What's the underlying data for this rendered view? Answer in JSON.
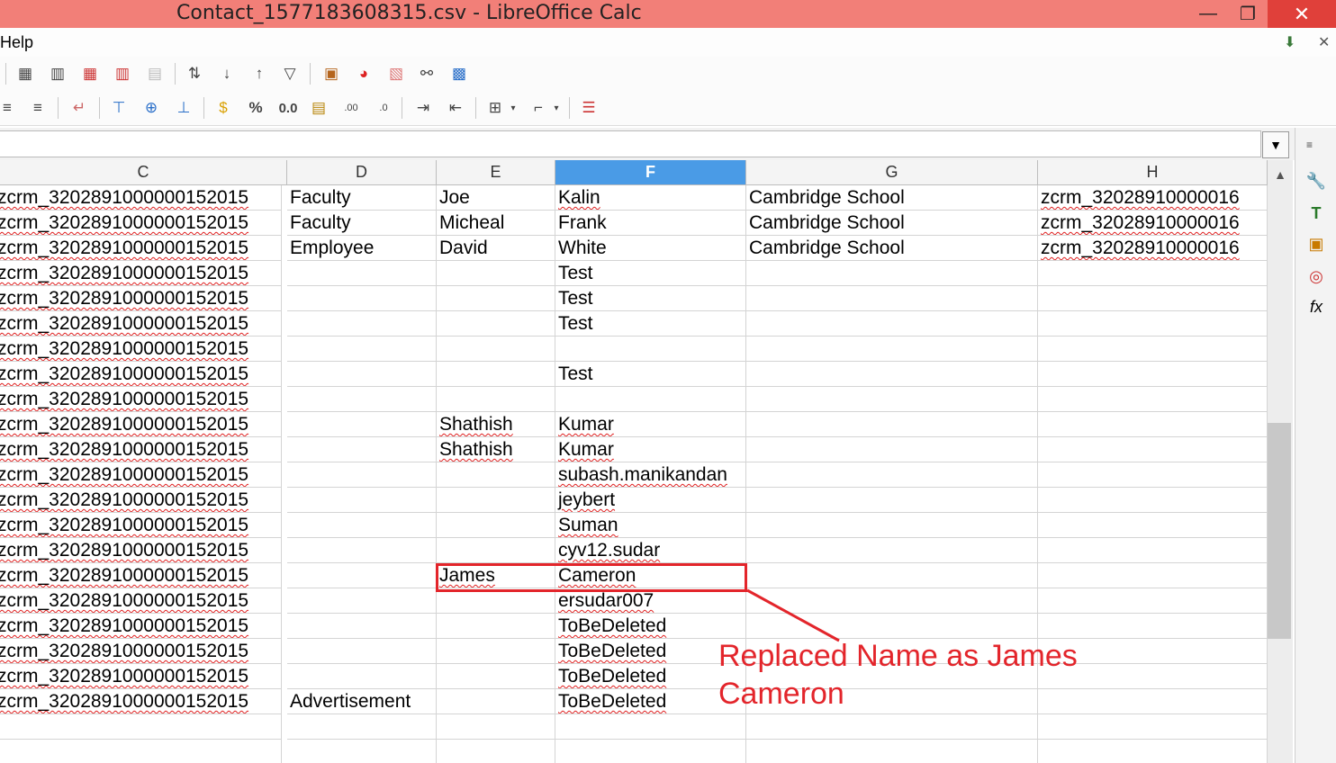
{
  "window": {
    "title": "Contact_1577183608315.csv - LibreOffice Calc",
    "minimize": "—",
    "maximize": "❐",
    "close": "✕"
  },
  "menu": {
    "help": "Help"
  },
  "formula": {
    "value": ""
  },
  "columns": [
    "C",
    "D",
    "E",
    "F",
    "G",
    "H"
  ],
  "selected_column": "F",
  "rows": [
    {
      "c": "zcrm_320289100000015201​5",
      "d": "Faculty",
      "e": "Joe",
      "f": "Kalin",
      "g": "Cambridge School",
      "h": "zcrm_32028910000016"
    },
    {
      "c": "zcrm_320289100000015201​5",
      "d": "Faculty",
      "e": "Micheal",
      "f": "Frank",
      "g": "Cambridge School",
      "h": "zcrm_32028910000016"
    },
    {
      "c": "zcrm_320289100000015201​5",
      "d": "Employee",
      "e": "David",
      "f": "White",
      "g": "Cambridge School",
      "h": "zcrm_32028910000016"
    },
    {
      "c": "zcrm_320289100000015201​5",
      "d": "",
      "e": "",
      "f": "Test",
      "g": "",
      "h": ""
    },
    {
      "c": "zcrm_320289100000015201​5",
      "d": "",
      "e": "",
      "f": "Test",
      "g": "",
      "h": ""
    },
    {
      "c": "zcrm_320289100000015201​5",
      "d": "",
      "e": "",
      "f": "Test",
      "g": "",
      "h": ""
    },
    {
      "c": "zcrm_320289100000015201​5",
      "d": "",
      "e": "",
      "f": "",
      "g": "",
      "h": ""
    },
    {
      "c": "zcrm_320289100000015201​5",
      "d": "",
      "e": "",
      "f": "Test",
      "g": "",
      "h": ""
    },
    {
      "c": "zcrm_320289100000015201​5",
      "d": "",
      "e": "",
      "f": "",
      "g": "",
      "h": ""
    },
    {
      "c": "zcrm_320289100000015201​5",
      "d": "",
      "e": "Shathish",
      "f": "Kumar",
      "g": "",
      "h": ""
    },
    {
      "c": "zcrm_320289100000015201​5",
      "d": "",
      "e": "Shathish",
      "f": "Kumar",
      "g": "",
      "h": ""
    },
    {
      "c": "zcrm_320289100000015201​5",
      "d": "",
      "e": "",
      "f": "subash.manikandan",
      "g": "",
      "h": ""
    },
    {
      "c": "zcrm_320289100000015201​5",
      "d": "",
      "e": "",
      "f": "jeybert",
      "g": "",
      "h": ""
    },
    {
      "c": "zcrm_320289100000015201​5",
      "d": "",
      "e": "",
      "f": "Suman",
      "g": "",
      "h": ""
    },
    {
      "c": "zcrm_320289100000015201​5",
      "d": "",
      "e": "",
      "f": "cyv12.sudar",
      "g": "",
      "h": ""
    },
    {
      "c": "zcrm_320289100000015201​5",
      "d": "",
      "e": "James",
      "f": "Cameron",
      "g": "",
      "h": ""
    },
    {
      "c": "zcrm_320289100000015201​5",
      "d": "",
      "e": "",
      "f": "ersudar007",
      "g": "",
      "h": ""
    },
    {
      "c": "zcrm_320289100000015201​5",
      "d": "",
      "e": "",
      "f": "ToBeDeleted",
      "g": "",
      "h": ""
    },
    {
      "c": "zcrm_320289100000015201​5",
      "d": "",
      "e": "",
      "f": "ToBeDeleted",
      "g": "",
      "h": ""
    },
    {
      "c": "zcrm_320289100000015201​5",
      "d": "",
      "e": "",
      "f": "ToBeDeleted",
      "g": "",
      "h": ""
    },
    {
      "c": "zcrm_320289100000015201​5",
      "d": "Advertisement",
      "e": "",
      "f": "ToBeDeleted",
      "g": "",
      "h": ""
    },
    {
      "c": "",
      "d": "",
      "e": "",
      "f": "",
      "g": "",
      "h": ""
    },
    {
      "c": "",
      "d": "",
      "e": "",
      "f": "",
      "g": "",
      "h": ""
    }
  ],
  "annotation": {
    "line1": "Replaced Name as James",
    "line2": "Cameron",
    "color": "#e3252b"
  },
  "toolbar_icons_row1": [
    "insert-row-icon",
    "insert-column-icon",
    "delete-row-icon",
    "delete-column-icon",
    "merge-cells-icon",
    "sort-icon",
    "sort-ascending-icon",
    "sort-descending-icon",
    "autofilter-icon",
    "insert-image-icon",
    "insert-chart-icon",
    "pivot-table-icon",
    "hyperlink-icon",
    "navigator-icon"
  ],
  "toolbar_icons_row2": [
    "align-center-icon",
    "align-right-icon",
    "wrap-text-icon",
    "align-top-icon",
    "align-middle-icon",
    "align-bottom-icon",
    "currency-icon",
    "percent-icon",
    "number-format-icon",
    "date-icon",
    "add-decimal-icon",
    "delete-decimal-icon",
    "increase-indent-icon",
    "decrease-indent-icon",
    "borders-icon",
    "border-style-icon",
    "conditional-icon"
  ],
  "toolbar_labels": {
    "percent": "%",
    "decimal": "0.0"
  }
}
